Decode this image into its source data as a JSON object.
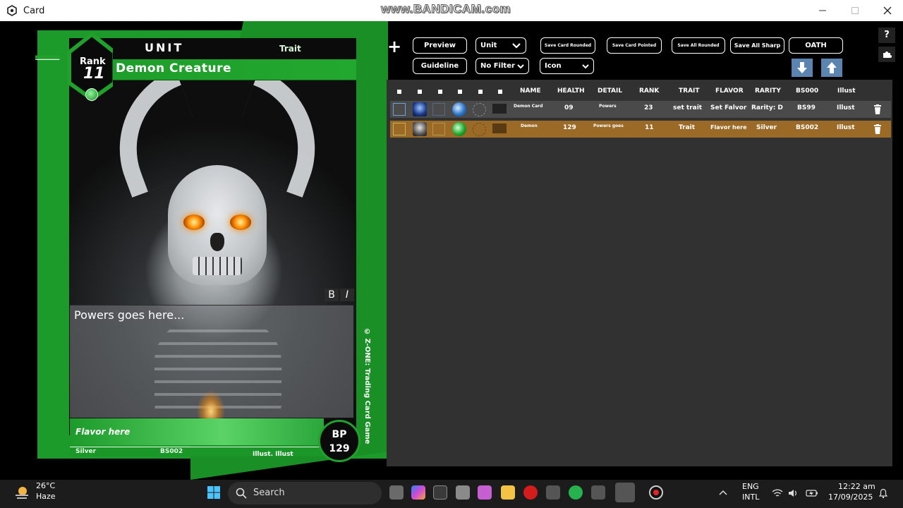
{
  "window": {
    "title": "Card",
    "watermark": "www.BANDICAM.com"
  },
  "card": {
    "type": "UNIT",
    "trait": "Trait",
    "name": "Demon Creature",
    "rank_word": "Rank",
    "rank": "11",
    "powers": "Powers goes here...",
    "flavor": "Flavor here",
    "rarity": "Silver",
    "set": "BS002",
    "illust": "Illust. Illust",
    "copyright": "© Z-ONE: Trading Card Game",
    "bp_label": "BP",
    "bp": "129",
    "format_bold": "B",
    "format_italic": "I",
    "colors": {
      "green": "#1c9a2a"
    }
  },
  "toolbar": {
    "add": "+",
    "preview": "Preview",
    "unit_select": "Unit",
    "save_rounded": "Save Card Rounded",
    "save_pointed": "Save Card Pointed",
    "save_all_rounded": "Save All Rounded",
    "save_all_sharp": "Save All Sharp",
    "oath": "OATH",
    "guideline": "Guideline",
    "filter_select": "No Filter",
    "icon_select": "Icon",
    "help": "?"
  },
  "table": {
    "headers": [
      "NAME",
      "HEALTH",
      "DETAIL",
      "RANK",
      "TRAIT",
      "FLAVOR",
      "RARITY",
      "BS000",
      "Illust"
    ],
    "rows": [
      {
        "name": "Demon Card",
        "health": "09",
        "detail": "Powers",
        "rank": "23",
        "trait": "set trait",
        "flavor": "Set Falvor",
        "rarity": "Rarity: D",
        "set": "BS99",
        "illust": "Illust"
      },
      {
        "name": "Demon",
        "health": "129",
        "detail": "Powers goes",
        "rank": "11",
        "trait": "Trait",
        "flavor": "Flavor here",
        "rarity": "Silver",
        "set": "BS002",
        "illust": "Illust"
      }
    ]
  },
  "taskbar": {
    "temp": "26°C",
    "weather": "Haze",
    "search": "Search",
    "lang1": "ENG",
    "lang2": "INTL",
    "time": "12:22 am",
    "date": "17/09/2025"
  }
}
